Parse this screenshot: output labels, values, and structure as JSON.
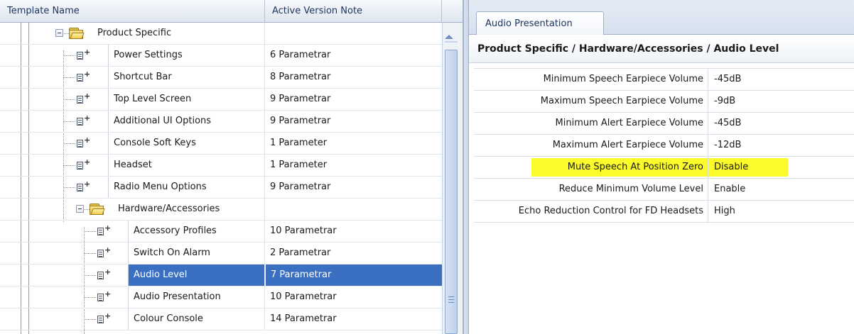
{
  "left": {
    "columns": {
      "name": "Template Name",
      "note": "Active Version Note"
    },
    "rows": [
      {
        "label": "Product Specific",
        "note": "",
        "kind": "folder",
        "level": 1
      },
      {
        "label": "Power Settings",
        "note": "6 Parametrar",
        "kind": "leaf",
        "level": 2
      },
      {
        "label": "Shortcut Bar",
        "note": "8 Parametrar",
        "kind": "leaf",
        "level": 2
      },
      {
        "label": "Top Level Screen",
        "note": "9 Parametrar",
        "kind": "leaf",
        "level": 2
      },
      {
        "label": "Additional UI Options",
        "note": "9 Parametrar",
        "kind": "leaf",
        "level": 2
      },
      {
        "label": "Console Soft Keys",
        "note": "1 Parameter",
        "kind": "leaf",
        "level": 2
      },
      {
        "label": "Headset",
        "note": "1 Parameter",
        "kind": "leaf",
        "level": 2
      },
      {
        "label": "Radio Menu Options",
        "note": "9 Parametrar",
        "kind": "leaf",
        "level": 2
      },
      {
        "label": "Hardware/Accessories",
        "note": "",
        "kind": "folder",
        "level": 2
      },
      {
        "label": "Accessory Profiles",
        "note": "10 Parametrar",
        "kind": "leaf",
        "level": 3
      },
      {
        "label": "Switch On Alarm",
        "note": "2 Parametrar",
        "kind": "leaf",
        "level": 3
      },
      {
        "label": "Audio Level",
        "note": "7 Parametrar",
        "kind": "leaf",
        "level": 3,
        "selected": true
      },
      {
        "label": "Audio Presentation",
        "note": "10 Parametrar",
        "kind": "leaf",
        "level": 3
      },
      {
        "label": "Colour Console",
        "note": "14 Parametrar",
        "kind": "leaf",
        "level": 3
      }
    ]
  },
  "right": {
    "tab_label": "Audio Presentation",
    "section_title": "Product Specific / Hardware/Accessories / Audio Level",
    "properties": [
      {
        "name": "Minimum Speech Earpiece Volume",
        "value": "-45dB"
      },
      {
        "name": "Maximum Speech Earpiece Volume",
        "value": "-9dB"
      },
      {
        "name": "Minimum Alert Earpiece Volume",
        "value": "-45dB"
      },
      {
        "name": "Maximum Alert Earpiece Volume",
        "value": "-12dB"
      },
      {
        "name": "Mute Speech At Position Zero",
        "value": "Disable",
        "highlighted": true
      },
      {
        "name": "Reduce Minimum Volume Level",
        "value": "Enable"
      },
      {
        "name": "Echo Reduction Control for FD Headsets",
        "value": "High"
      }
    ],
    "highlight_color": "#fbfb2c"
  },
  "colors": {
    "selection": "#3a6fc2",
    "header_text": "#1d3660"
  }
}
